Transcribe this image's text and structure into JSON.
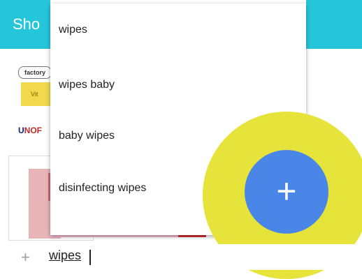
{
  "header": {
    "title": "Sho"
  },
  "background": {
    "badge": "factory",
    "yellow_text": "Vit",
    "logo": {
      "prefix": "U",
      "text": "NOF"
    }
  },
  "suggestions": [
    {
      "label": "wipes"
    },
    {
      "label": "wipes baby"
    },
    {
      "label": "baby wipes"
    },
    {
      "label": "disinfecting wipes"
    }
  ],
  "fab": {
    "icon": "+"
  },
  "input": {
    "add_icon": "+",
    "value": "wipes"
  },
  "colors": {
    "topbar": "#26c6da",
    "fab": "#4a86e8",
    "highlight": "#e6e33a"
  }
}
